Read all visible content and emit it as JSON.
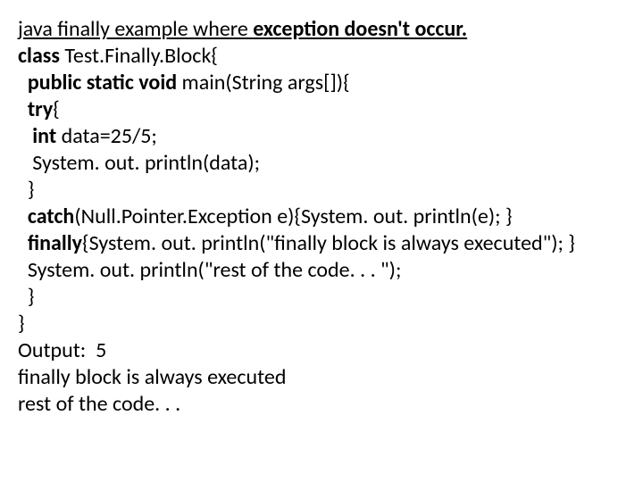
{
  "title_plain": "java finally example where ",
  "title_bold": "exception doesn't occur.",
  "code": {
    "l1a": "class",
    "l1b": " Test.Finally.Block{",
    "l2a": "  public static void",
    "l2b": " main(String args[]){",
    "l3a": "  try",
    "l3b": "{",
    "l4a": "   int",
    "l4b": " data=25/5;",
    "l5": "   System. out. println(data);",
    "l6": "  }",
    "l7a": "  catch",
    "l7b": "(Null.Pointer.Exception e){System. out. println(e); }",
    "l8a": "  finally",
    "l8b": "{System. out. println(\"finally block is always executed\"); }",
    "l9": "  System. out. println(\"rest of the code. . . \");",
    "l10": "  }",
    "l11": "}",
    "out_label": "Output:  ",
    "out_val": "5",
    "out2": "finally block is always executed",
    "out3": "rest of the code. . ."
  }
}
